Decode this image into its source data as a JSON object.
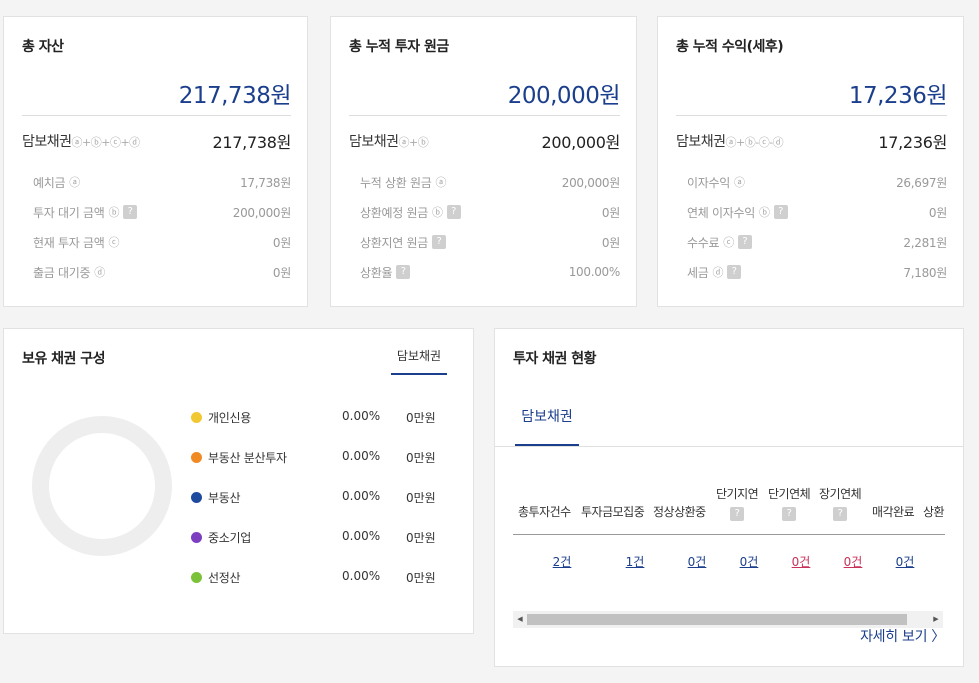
{
  "summary_cards": [
    {
      "title": "총 자산",
      "total": "217,738원",
      "main_label": "담보채권",
      "main_formula": "ⓐ+ⓑ+ⓒ+ⓓ",
      "main_value": "217,738원",
      "rows": [
        {
          "label": "예치금",
          "mark": "ⓐ",
          "help": false,
          "value": "17,738원"
        },
        {
          "label": "투자 대기 금액",
          "mark": "ⓑ",
          "help": true,
          "value": "200,000원"
        },
        {
          "label": "현재 투자 금액",
          "mark": "ⓒ",
          "help": false,
          "value": "0원"
        },
        {
          "label": "출금 대기중",
          "mark": "ⓓ",
          "help": false,
          "value": "0원"
        }
      ]
    },
    {
      "title": "총 누적 투자 원금",
      "total": "200,000원",
      "main_label": "담보채권",
      "main_formula": "ⓐ+ⓑ",
      "main_value": "200,000원",
      "rows": [
        {
          "label": "누적 상환 원금",
          "mark": "ⓐ",
          "help": false,
          "value": "200,000원"
        },
        {
          "label": "상환예정 원금",
          "mark": "ⓑ",
          "help": true,
          "value": "0원"
        },
        {
          "label": "상환지연 원금",
          "mark": "",
          "help": true,
          "value": "0원"
        },
        {
          "label": "상환율",
          "mark": "",
          "help": true,
          "value": "100.00%"
        }
      ]
    },
    {
      "title": "총 누적 수익(세후)",
      "total": "17,236원",
      "main_label": "담보채권",
      "main_formula": "ⓐ+ⓑ-ⓒ-ⓓ",
      "main_value": "17,236원",
      "rows": [
        {
          "label": "이자수익",
          "mark": "ⓐ",
          "help": false,
          "value": "26,697원"
        },
        {
          "label": "연체 이자수익",
          "mark": "ⓑ",
          "help": true,
          "value": "0원"
        },
        {
          "label": "수수료",
          "mark": "ⓒ",
          "help": true,
          "value": "2,281원"
        },
        {
          "label": "세금",
          "mark": "ⓓ",
          "help": true,
          "value": "7,180원"
        }
      ]
    }
  ],
  "holdings": {
    "title": "보유 채권 구성",
    "tab": "담보채권",
    "legend": [
      {
        "name": "개인신용",
        "color": "#f2c734",
        "pct": "0.00%",
        "amount": "0만원"
      },
      {
        "name": "부동산 분산투자",
        "color": "#f08a24",
        "pct": "0.00%",
        "amount": "0만원"
      },
      {
        "name": "부동산",
        "color": "#1e4b9e",
        "pct": "0.00%",
        "amount": "0만원"
      },
      {
        "name": "중소기업",
        "color": "#7b3fc0",
        "pct": "0.00%",
        "amount": "0만원"
      },
      {
        "name": "선정산",
        "color": "#7cc13a",
        "pct": "0.00%",
        "amount": "0만원"
      }
    ]
  },
  "investment_status": {
    "title": "투자 채권 현황",
    "tab": "담보채권",
    "help_glyph": "?",
    "columns": [
      {
        "header": "총투자건수",
        "help": false,
        "count": "2건",
        "color": "#1b3f8c"
      },
      {
        "header": "투자금모집중",
        "help": false,
        "count": "1건",
        "color": "#1b3f8c"
      },
      {
        "header": "정상상환중",
        "help": false,
        "count": "0건",
        "color": "#1b3f8c"
      },
      {
        "header": "단기지연",
        "help": true,
        "count": "0건",
        "color": "#1b3f8c"
      },
      {
        "header": "단기연체",
        "help": true,
        "count": "0건",
        "color": "#c8325a"
      },
      {
        "header": "장기연체",
        "help": true,
        "count": "0건",
        "color": "#c8325a"
      },
      {
        "header": "매각완료",
        "help": false,
        "count": "0건",
        "color": "#1b3f8c"
      },
      {
        "header": "상환",
        "help": false,
        "count": "",
        "color": "#1b3f8c"
      }
    ],
    "more_link": "자세히 보기 〉"
  }
}
